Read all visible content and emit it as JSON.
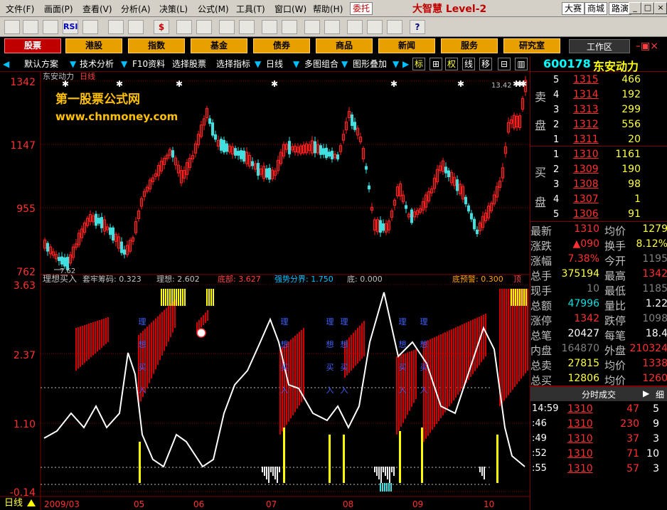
{
  "menu": {
    "items": [
      "文件(F)",
      "画面(P)",
      "查看(V)",
      "分析(A)",
      "决策(L)",
      "公式(M)",
      "工具(T)",
      "窗口(W)",
      "帮助(H)"
    ],
    "entrust": "委托",
    "brand": "大智慧 Level-2",
    "right_buttons": [
      "大赛",
      "商城",
      "路演"
    ]
  },
  "category_tabs": [
    "股票",
    "港股",
    "指数",
    "基金",
    "债券",
    "商品",
    "新闻",
    "服务",
    "研究室"
  ],
  "workspace_label": "工作区",
  "subbar": {
    "items": [
      "默认方案",
      "技术分析",
      "F10资料",
      "选择股票",
      "选择指标",
      "日线",
      "多图组合",
      "图形叠加"
    ],
    "right_items": [
      "标",
      "权",
      "线",
      "移"
    ]
  },
  "chart": {
    "title": "东安动力",
    "period": "日线",
    "watermark_line1": "第一股票公式网",
    "watermark_line2": "www.chnmoney.com",
    "main_axis": [
      "1342",
      "1147",
      "955",
      "762"
    ],
    "high_label": "13.42",
    "low_label": "7.62",
    "indicator_header": {
      "name": "理想买入",
      "items": [
        "套牢筹码: 0.323",
        "理想: 2.602",
        "底部: 3.627",
        "强势分界: 1.750",
        "底: 0.000"
      ],
      "right_label": "底预警: 0.300",
      "right_suffix": "顶"
    },
    "indicator_axis": [
      "3.63",
      "2.37",
      "1.10",
      "-0.14"
    ],
    "indicator_marker_labels": [
      "理",
      "想",
      "买",
      "入"
    ],
    "date_axis": [
      "2009/03",
      "05",
      "06",
      "07",
      "08",
      "09",
      "10"
    ],
    "period_footer": "日线",
    "colors": {
      "up": "#ff2020",
      "down": "#40e0e0",
      "grid": "#800000",
      "line": "#ffffff",
      "bar_red": "#d00000",
      "bar_yellow": "#ffff00"
    }
  },
  "chart_data": {
    "type": "candlestick",
    "title": "东安动力",
    "ylim": [
      7.62,
      13.42
    ],
    "indicator_ylim": [
      -0.14,
      3.63
    ]
  },
  "quote": {
    "code": "600178",
    "name": "东安动力",
    "sell_label": [
      "卖",
      "盘"
    ],
    "buy_label": [
      "买",
      "盘"
    ],
    "asks": [
      {
        "level": "5",
        "price": "1315",
        "vol": "466"
      },
      {
        "level": "4",
        "price": "1314",
        "vol": "192"
      },
      {
        "level": "3",
        "price": "1313",
        "vol": "299"
      },
      {
        "level": "2",
        "price": "1312",
        "vol": "556"
      },
      {
        "level": "1",
        "price": "1311",
        "vol": "20"
      }
    ],
    "bids": [
      {
        "level": "1",
        "price": "1310",
        "vol": "1161"
      },
      {
        "level": "2",
        "price": "1309",
        "vol": "190"
      },
      {
        "level": "3",
        "price": "1308",
        "vol": "98"
      },
      {
        "level": "4",
        "price": "1307",
        "vol": "1"
      },
      {
        "level": "5",
        "price": "1306",
        "vol": "91"
      }
    ],
    "stats": [
      {
        "l1": "最新",
        "v1": "1310",
        "l2": "均价",
        "v2": "1279"
      },
      {
        "l1": "涨跌",
        "v1": "▲090",
        "l2": "换手",
        "v2": "8.12%"
      },
      {
        "l1": "涨幅",
        "v1": "7.38%",
        "l2": "今开",
        "v2": "1195"
      },
      {
        "l1": "总手",
        "v1": "375194",
        "l2": "最高",
        "v2": "1342"
      },
      {
        "l1": "现手",
        "v1": "10",
        "l2": "最低",
        "v2": "1185"
      },
      {
        "l1": "总额",
        "v1": "47996",
        "l2": "量比",
        "v2": "1.22"
      },
      {
        "l1": "涨停",
        "v1": "1342",
        "l2": "跌停",
        "v2": "1098"
      },
      {
        "l1": "总笔",
        "v1": "20427",
        "l2": "每笔",
        "v2": "18.4"
      },
      {
        "l1": "内盘",
        "v1": "164870",
        "l2": "外盘",
        "v2": "210324"
      },
      {
        "l1": "总卖",
        "v1": "27815",
        "l2": "均价",
        "v2": "1338"
      },
      {
        "l1": "总买",
        "v1": "12806",
        "l2": "均价",
        "v2": "1260"
      }
    ],
    "trades_header": "分时成交",
    "trades_tab": "细",
    "trades": [
      {
        "time": "14:59",
        "price": "1310",
        "vol": "47",
        "n": "5"
      },
      {
        "time": ":46",
        "price": "1310",
        "vol": "230",
        "n": "9"
      },
      {
        "time": ":49",
        "price": "1310",
        "vol": "37",
        "n": "3"
      },
      {
        "time": ":52",
        "price": "1310",
        "vol": "71",
        "n": "10"
      },
      {
        "time": ":55",
        "price": "1310",
        "vol": "57",
        "n": "3"
      }
    ]
  }
}
